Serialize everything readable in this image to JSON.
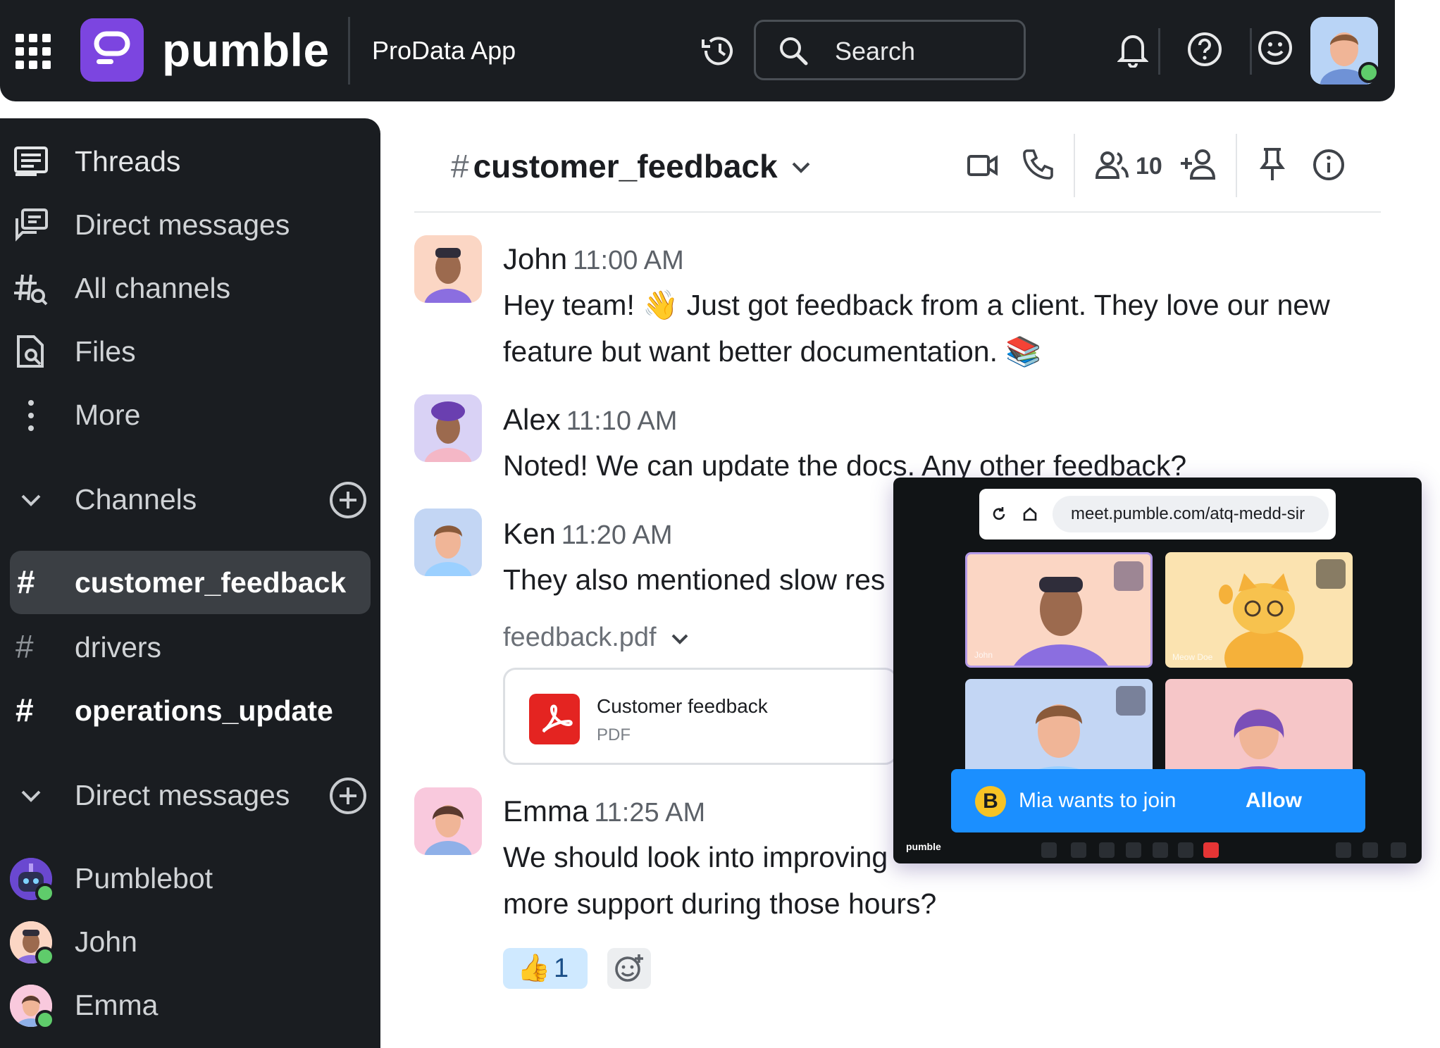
{
  "topbar": {
    "brand": "pumble",
    "workspace": "ProData App",
    "search_placeholder": "Search"
  },
  "sidebar": {
    "nav": [
      {
        "label": "Threads",
        "icon": "threads-icon"
      },
      {
        "label": "Direct messages",
        "icon": "direct-messages-icon"
      },
      {
        "label": "All channels",
        "icon": "all-channels-icon"
      },
      {
        "label": "Files",
        "icon": "files-icon"
      },
      {
        "label": "More",
        "icon": "more-vertical-icon"
      }
    ],
    "channels_header": "Channels",
    "channels": [
      {
        "name": "customer_feedback",
        "active": true
      },
      {
        "name": "drivers",
        "active": false
      },
      {
        "name": "operations_update",
        "bold": true
      }
    ],
    "dm_header": "Direct messages",
    "dms": [
      {
        "name": "Pumblebot"
      },
      {
        "name": "John"
      },
      {
        "name": "Emma"
      }
    ]
  },
  "channel": {
    "hash": "#",
    "name": "customer_feedback",
    "member_count": "10"
  },
  "messages": [
    {
      "author": "John",
      "time": "11:00 AM",
      "lines": [
        "Hey team! 👋 Just got feedback from a client. They love our new",
        "feature but want better documentation. 📚"
      ]
    },
    {
      "author": "Alex",
      "time": "11:10 AM",
      "lines": [
        "Noted! We can update the docs. Any other feedback?"
      ]
    },
    {
      "author": "Ken",
      "time": "11:20 AM",
      "lines": [
        "They also mentioned slow res"
      ]
    },
    {
      "author": "Emma",
      "time": "11:25 AM",
      "lines": [
        "We should look into improving",
        "more support during those hours?"
      ]
    }
  ],
  "attachment": {
    "label": "feedback.pdf",
    "title": "Customer feedback",
    "type": "PDF"
  },
  "reaction": {
    "emoji": "👍",
    "count": "1"
  },
  "meeting": {
    "url": "meet.pumble.com/atq-medd-sir",
    "tiles": [
      {
        "name": "John",
        "color": "#fbd6c4"
      },
      {
        "name": "Meow Doe",
        "color": "#fbe3b0"
      },
      {
        "name": "",
        "color": "#c3d6f4"
      },
      {
        "name": "",
        "color": "#f6c6c8"
      }
    ],
    "join_badge": "B",
    "join_text": "Mia wants to join",
    "join_action": "Allow",
    "logo": "pumble"
  },
  "colors": {
    "brand": "#7c45e0",
    "dark": "#1a1d21",
    "accent": "#1b8fff",
    "online": "#5fcc6b"
  }
}
